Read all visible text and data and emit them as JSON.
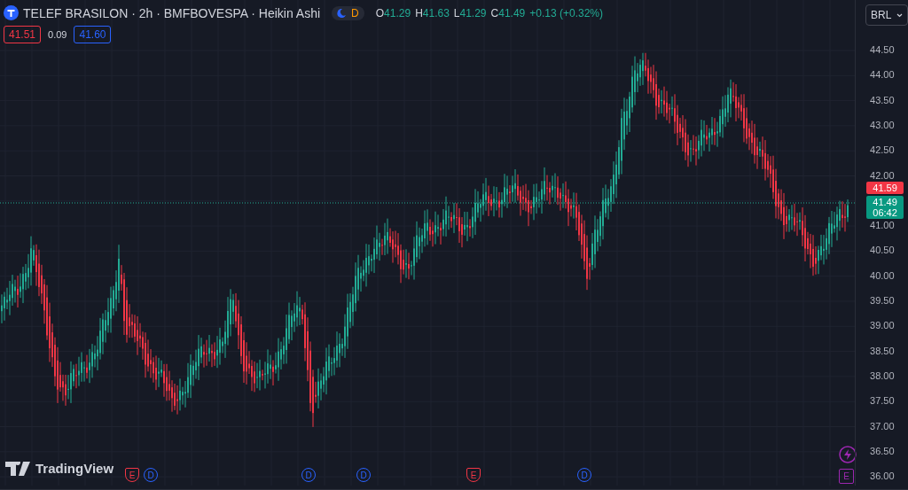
{
  "legend": {
    "title": "TELEF BRASILON · 2h · BMFBOVESPA · Heikin Ashi",
    "session_badge": "D",
    "ohlc": [
      {
        "label": "O",
        "value": "41.29"
      },
      {
        "label": "H",
        "value": "41.63"
      },
      {
        "label": "L",
        "value": "41.29"
      },
      {
        "label": "C",
        "value": "41.49"
      }
    ],
    "change": "+0.13 (+0.32%)"
  },
  "quote": {
    "bid": "41.51",
    "spread": "0.09",
    "ask": "41.60"
  },
  "currency": "BRL",
  "price_axis": {
    "ticks": [
      "44.50",
      "44.00",
      "43.50",
      "43.00",
      "42.50",
      "42.00",
      "41.00",
      "40.50",
      "40.00",
      "39.50",
      "39.00",
      "38.50",
      "38.00",
      "37.50",
      "37.00",
      "36.50",
      "36.00"
    ]
  },
  "price_labels": [
    {
      "kind": "high",
      "value": "41.59"
    },
    {
      "kind": "last",
      "value": "41.49",
      "countdown": "06:42"
    }
  ],
  "events": [
    {
      "kind": "earnings",
      "label": "E",
      "color": "#f23645"
    },
    {
      "kind": "dividend",
      "label": "D",
      "color": "#2962ff"
    },
    {
      "kind": "dividend",
      "label": "D",
      "color": "#2962ff"
    },
    {
      "kind": "dividend",
      "label": "D",
      "color": "#2962ff"
    },
    {
      "kind": "earnings",
      "label": "E",
      "color": "#f23645"
    },
    {
      "kind": "dividend",
      "label": "D",
      "color": "#2962ff"
    }
  ],
  "axis_events": [
    {
      "kind": "news",
      "color": "#9c27b0"
    },
    {
      "kind": "earnings",
      "label": "E",
      "color": "#9c27b0"
    }
  ],
  "logo": "TradingView"
}
